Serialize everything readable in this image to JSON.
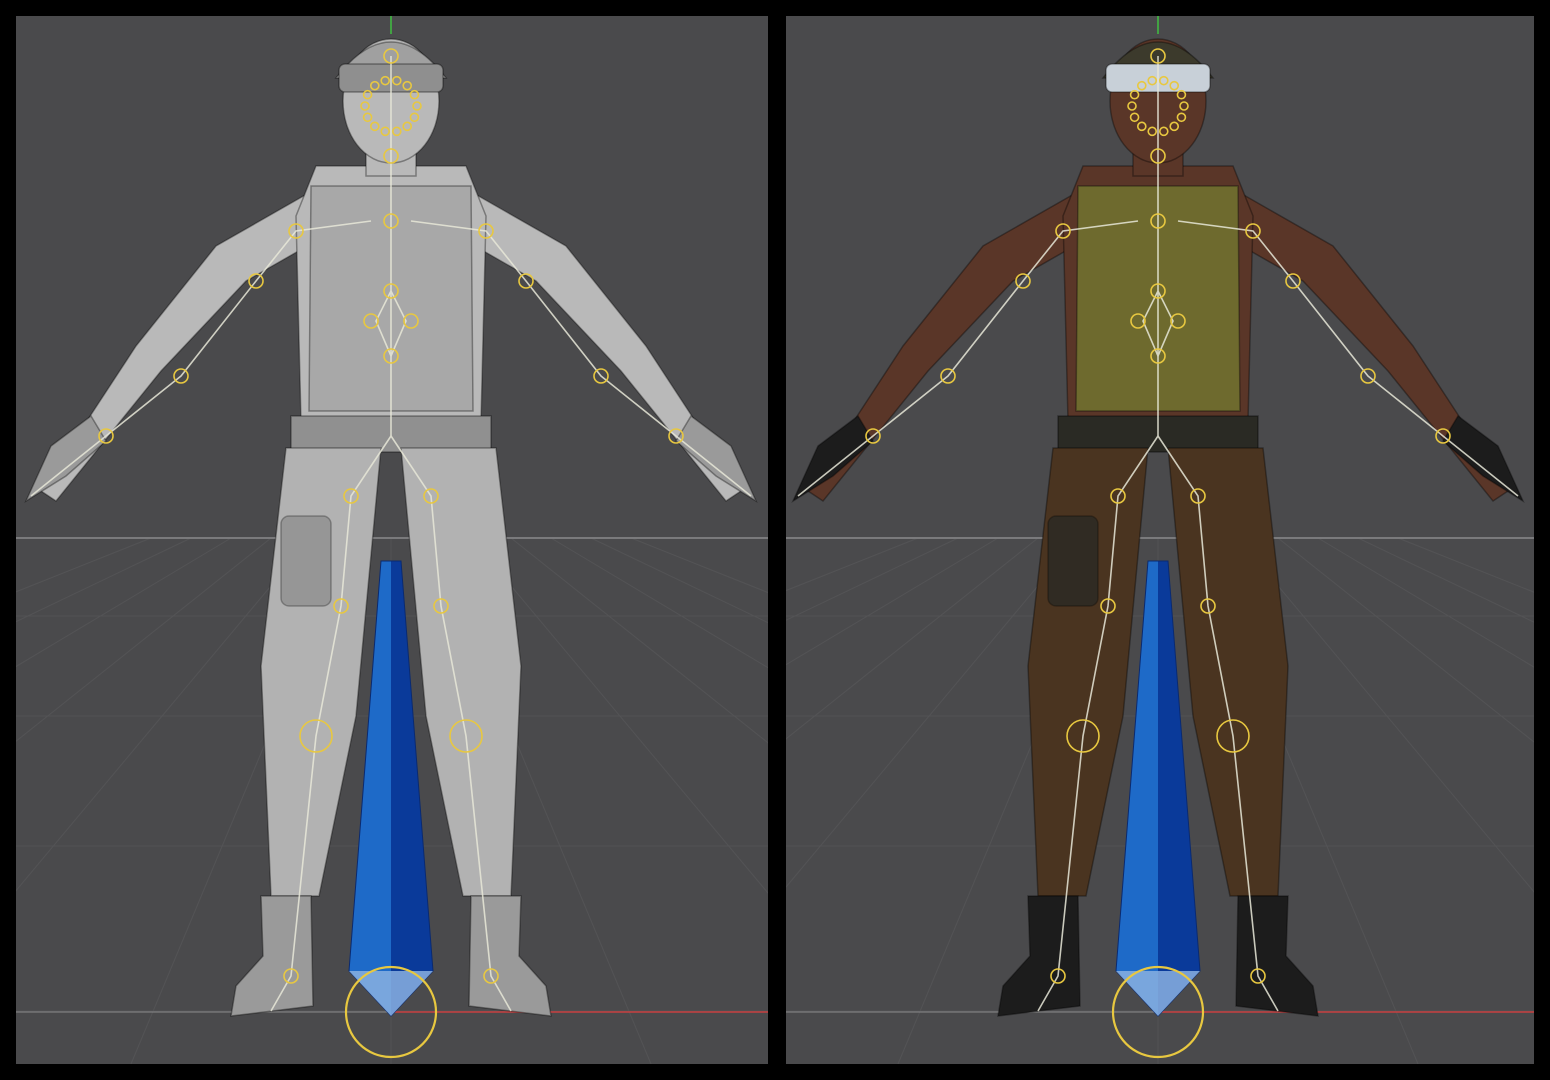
{
  "scene": {
    "background_color": "#4a4a4c",
    "grid_color": "#5c5c5e",
    "horizon_color": "#7a7a7c",
    "x_axis_color": "#c84040",
    "y_axis_color": "#40c040",
    "bone_color": "#e8e8d8",
    "joint_color": "#e8c840",
    "root_bone_color": "#0a3a9a",
    "root_bone_highlight": "#1e6ac8",
    "root_tip_color": "#8ab0e0"
  },
  "viewports": [
    {
      "id": "untextured",
      "shading": "solid",
      "icons": [
        "character-mesh-icon",
        "skeleton-rig-icon",
        "root-bone-icon",
        "root-control-circle-icon"
      ],
      "colors": {
        "skin": "#b9b9b9",
        "vest": "#a8a8a8",
        "pants": "#b2b2b2",
        "helmet": "#a0a0a0",
        "visor": "#8f8f8f",
        "boots": "#9a9a9a",
        "belt": "#909090"
      }
    },
    {
      "id": "textured",
      "shading": "textured",
      "icons": [
        "character-mesh-icon",
        "skeleton-rig-icon",
        "root-bone-icon",
        "root-control-circle-icon"
      ],
      "colors": {
        "skin": "#5a3628",
        "vest": "#6e6a2e",
        "pants": "#4a3420",
        "helmet": "#3c3a2c",
        "visor": "#c8d0d8",
        "boots": "#1c1c1c",
        "belt": "#2a2a24"
      }
    }
  ]
}
